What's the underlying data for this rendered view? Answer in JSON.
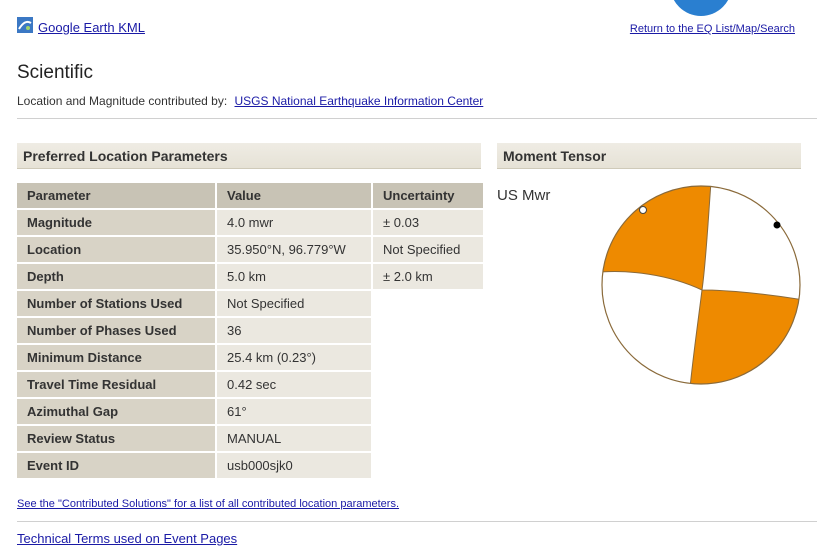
{
  "header": {
    "kml_label": "Google Earth KML",
    "return_label": "Return to the EQ List/Map/Search"
  },
  "page_title": "Scientific",
  "contributor": {
    "prefix": "Location and Magnitude contributed by:",
    "link_label": "USGS National Earthquake Information Center"
  },
  "location_section": {
    "title": "Preferred Location Parameters",
    "columns": [
      "Parameter",
      "Value",
      "Uncertainty"
    ],
    "rows": [
      {
        "parameter": "Magnitude",
        "value": "4.0 mwr",
        "uncertainty": "± 0.03"
      },
      {
        "parameter": "Location",
        "value": "35.950°N, 96.779°W",
        "uncertainty": "Not Specified"
      },
      {
        "parameter": "Depth",
        "value": "5.0 km",
        "uncertainty": "± 2.0 km"
      },
      {
        "parameter": "Number of Stations Used",
        "value": "Not Specified"
      },
      {
        "parameter": "Number of Phases Used",
        "value": "36"
      },
      {
        "parameter": "Minimum Distance",
        "value": "25.4 km (0.23°)"
      },
      {
        "parameter": "Travel Time Residual",
        "value": "0.42 sec"
      },
      {
        "parameter": "Azimuthal Gap",
        "value": "61°"
      },
      {
        "parameter": "Review Status",
        "value": "MANUAL"
      },
      {
        "parameter": "Event ID",
        "value": "usb000sjk0"
      }
    ]
  },
  "moment_tensor": {
    "title": "Moment Tensor",
    "label": "US Mwr",
    "fill_color": "#ee8a00",
    "outline_color": "#8a6a3a"
  },
  "footer": {
    "contributed_link": "See the \"Contributed Solutions\" for a list of all contributed location parameters.",
    "technical_terms_link": "Technical Terms used on Event Pages"
  },
  "colors": {
    "link": "#1a1aa6",
    "header_bg": "#c8c3b5",
    "label_bg": "#d8d3c6",
    "value_bg": "#ebe8e0"
  }
}
